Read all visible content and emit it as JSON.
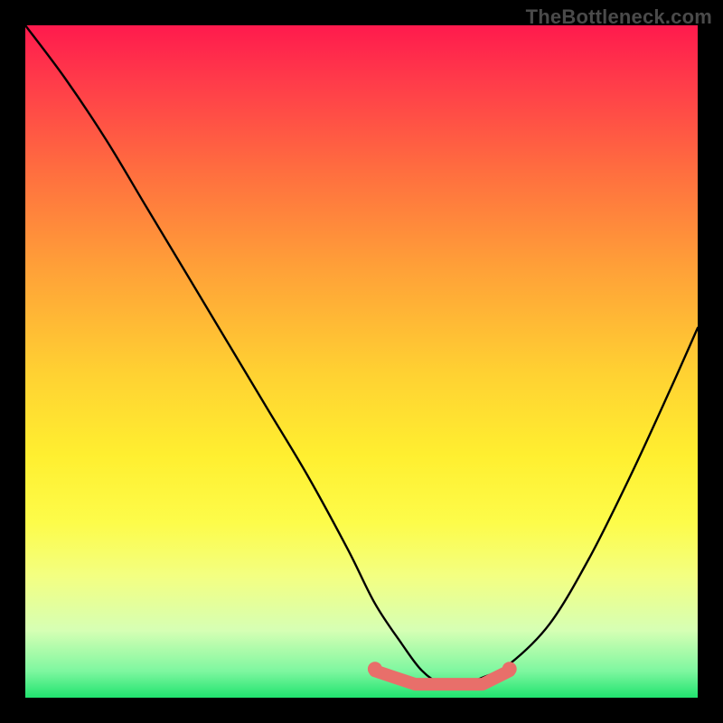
{
  "watermark": "TheBottleneck.com",
  "chart_data": {
    "type": "line",
    "title": "",
    "xlabel": "",
    "ylabel": "",
    "x_range": [
      0,
      100
    ],
    "y_range": [
      0,
      100
    ],
    "series": [
      {
        "name": "curve",
        "x": [
          0,
          6,
          12,
          18,
          24,
          30,
          36,
          42,
          48,
          52,
          56,
          59,
          62,
          65,
          68,
          72,
          78,
          84,
          90,
          96,
          100
        ],
        "y": [
          100,
          92,
          83,
          73,
          63,
          53,
          43,
          33,
          22,
          14,
          8,
          4,
          2,
          2,
          3,
          5,
          11,
          21,
          33,
          46,
          55
        ]
      }
    ],
    "markers": {
      "name": "baseline-highlight",
      "color_hex": "#e86f6a",
      "x": [
        52,
        55,
        58,
        60,
        62,
        64,
        66,
        68,
        70,
        72
      ],
      "y": [
        4,
        3,
        2,
        2,
        2,
        2,
        2,
        2,
        3,
        4
      ]
    },
    "background": {
      "type": "vertical-gradient",
      "stops": [
        {
          "pos": 0.0,
          "hex": "#ff1a4d"
        },
        {
          "pos": 0.22,
          "hex": "#ff6f3f"
        },
        {
          "pos": 0.52,
          "hex": "#ffd232"
        },
        {
          "pos": 0.82,
          "hex": "#f3ff82"
        },
        {
          "pos": 1.0,
          "hex": "#20e36f"
        }
      ]
    }
  }
}
